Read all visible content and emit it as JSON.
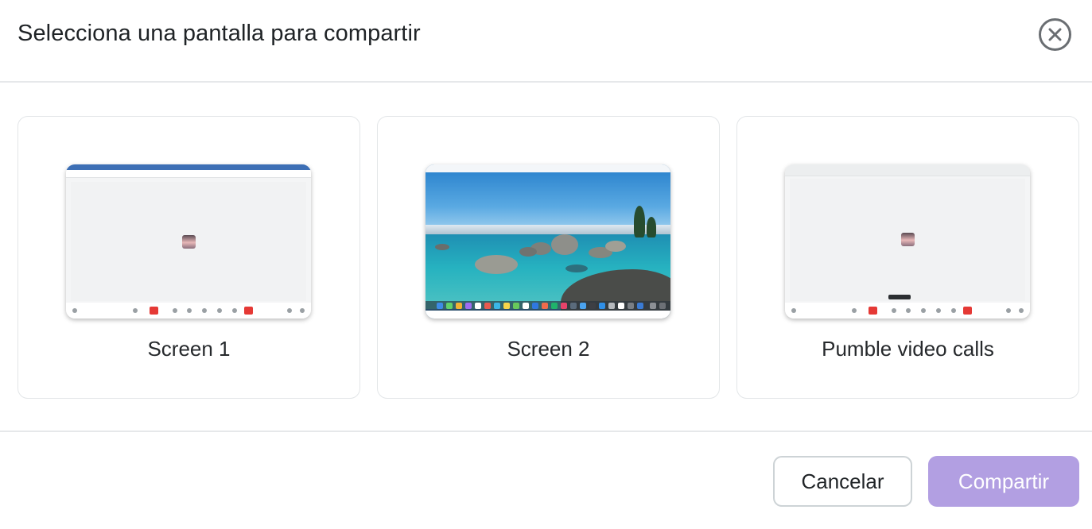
{
  "dialog": {
    "title": "Selecciona una pantalla para compartir",
    "close_icon": "close-circle-icon"
  },
  "sources": [
    {
      "label": "Screen 1"
    },
    {
      "label": "Screen 2"
    },
    {
      "label": "Pumble video calls"
    }
  ],
  "footer": {
    "cancel_label": "Cancelar",
    "share_label": "Compartir",
    "share_enabled": false
  },
  "colors": {
    "accent": "#b29fe2",
    "border": "#e3e6e8",
    "text": "#1f2326"
  }
}
